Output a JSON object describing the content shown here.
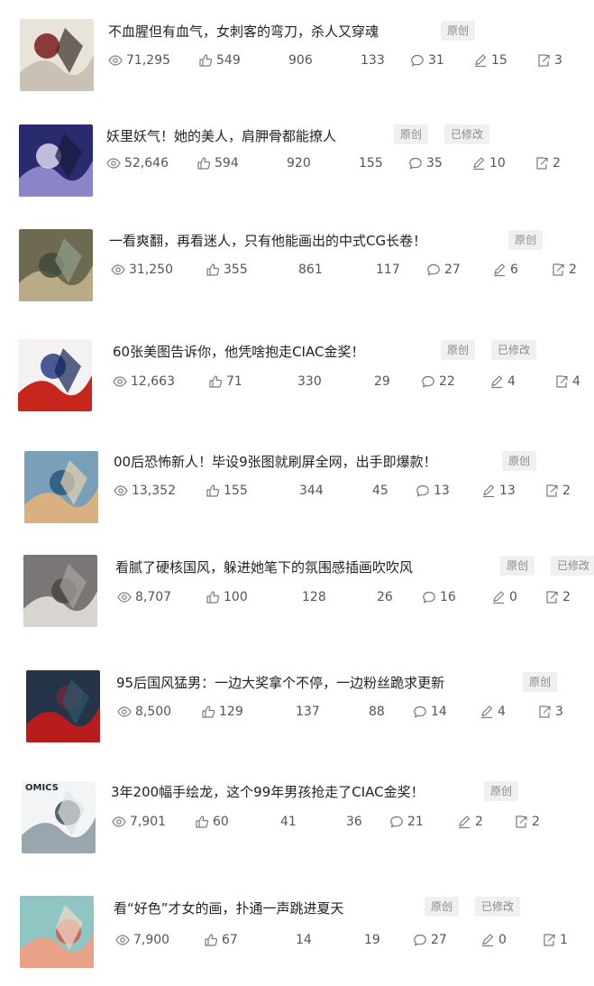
{
  "colors": {
    "icon": "#7a7a7a",
    "badge_bg": "#f0f0f0",
    "badge_text": "#8a8a8a",
    "title": "#222222",
    "stat": "#555555"
  },
  "articles": [
    {
      "title": "不血腥但有血气，女刺客的弯刀，杀人又穿魂",
      "badges": [
        "原创"
      ],
      "views": "71,295",
      "likes": "549",
      "col3": "906",
      "col4": "133",
      "comments": "31",
      "edits": "15",
      "shares": "3",
      "thumb_icon": "illustration-thumbnail"
    },
    {
      "title": "妖里妖气！她的美人，肩胛骨都能撩人",
      "badges": [
        "原创",
        "已修改"
      ],
      "views": "52,646",
      "likes": "594",
      "col3": "920",
      "col4": "155",
      "comments": "35",
      "edits": "10",
      "shares": "2",
      "thumb_icon": "illustration-thumbnail"
    },
    {
      "title": "一看爽翻，再看迷人，只有他能画出的中式CG长卷！",
      "badges": [
        "原创"
      ],
      "views": "31,250",
      "likes": "355",
      "col3": "861",
      "col4": "117",
      "comments": "27",
      "edits": "6",
      "shares": "2",
      "thumb_icon": "illustration-thumbnail"
    },
    {
      "title": "60张美图告诉你，他凭啥抱走CIAC金奖！",
      "badges": [
        "原创",
        "已修改"
      ],
      "views": "12,663",
      "likes": "71",
      "col3": "330",
      "col4": "29",
      "comments": "22",
      "edits": "4",
      "shares": "4",
      "thumb_icon": "illustration-thumbnail"
    },
    {
      "title": "00后恐怖新人！毕设9张图就刷屏全网，出手即爆款！",
      "badges": [
        "原创"
      ],
      "views": "13,352",
      "likes": "155",
      "col3": "344",
      "col4": "45",
      "comments": "13",
      "edits": "13",
      "shares": "2",
      "thumb_icon": "illustration-thumbnail"
    },
    {
      "title": "看腻了硬核国风，躲进她笔下的氛围感插画吹吹风",
      "badges": [
        "原创",
        "已修改"
      ],
      "views": "8,707",
      "likes": "100",
      "col3": "128",
      "col4": "26",
      "comments": "16",
      "edits": "0",
      "shares": "2",
      "thumb_icon": "illustration-thumbnail"
    },
    {
      "title": "95后国风猛男：一边大奖拿个不停，一边粉丝跪求更新",
      "badges": [
        "原创"
      ],
      "views": "8,500",
      "likes": "129",
      "col3": "137",
      "col4": "88",
      "comments": "14",
      "edits": "4",
      "shares": "3",
      "thumb_icon": "illustration-thumbnail"
    },
    {
      "title": "3年200幅手绘龙，这个99年男孩抢走了CIAC金奖！",
      "badges": [
        "原创"
      ],
      "views": "7,901",
      "likes": "60",
      "col3": "41",
      "col4": "36",
      "comments": "21",
      "edits": "2",
      "shares": "2",
      "thumb_icon": "illustration-thumbnail",
      "thumb_text": "OMICS"
    },
    {
      "title": "看“好色”才女的画，扑通一声跳进夏天",
      "badges": [
        "原创",
        "已修改"
      ],
      "views": "7,900",
      "likes": "67",
      "col3": "14",
      "col4": "19",
      "comments": "27",
      "edits": "0",
      "shares": "1",
      "thumb_icon": "illustration-thumbnail"
    }
  ]
}
